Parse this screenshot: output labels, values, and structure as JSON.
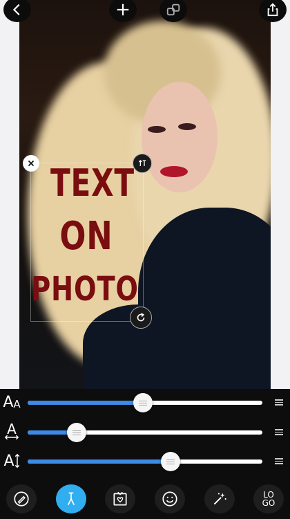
{
  "topbar": {
    "back_icon": "chevron-left-icon",
    "add_icon": "plus-icon",
    "link_icon": "link-chain-icon",
    "share_icon": "share-icon"
  },
  "overlay": {
    "lines": [
      "TEXT",
      "ON",
      "PHOTO"
    ],
    "text_color": "#7a0d10",
    "close_icon": "close-icon",
    "flip_icon": "text-flip-icon",
    "rotate_icon": "rotate-icon"
  },
  "sliders": [
    {
      "label": "AA",
      "name": "font-size",
      "value": 0.49
    },
    {
      "label": "A",
      "name": "letter-spacing",
      "value": 0.21
    },
    {
      "label": "A↕",
      "name": "line-height",
      "value": 0.61
    }
  ],
  "toolbar": {
    "tools": [
      "pen-nib-icon",
      "text-style-icon",
      "sticker-frame-icon",
      "emoji-icon",
      "magic-wand-icon",
      "logo-icon"
    ],
    "logo_text_top": "LO",
    "logo_text_bottom": "GO",
    "active_index": 1,
    "accent_color": "#31aef0"
  }
}
